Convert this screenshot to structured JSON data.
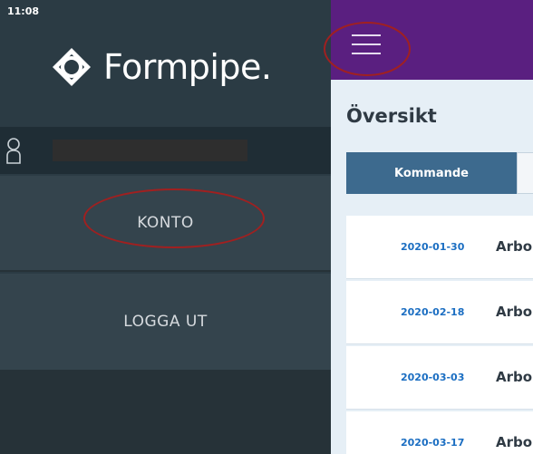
{
  "status_bar": {
    "time": "11:08"
  },
  "sidebar": {
    "logo_text": "Formpipe.",
    "menu": [
      {
        "label": "KONTO"
      },
      {
        "label": "LOGGA UT"
      }
    ]
  },
  "main": {
    "title": "Översikt",
    "tabs": [
      {
        "label": "Kommande"
      },
      {
        "label": ""
      }
    ],
    "items": [
      {
        "date": "2020-01-30",
        "title": "Arbo"
      },
      {
        "date": "2020-02-18",
        "title": "Arbo"
      },
      {
        "date": "2020-03-03",
        "title": "Arbo"
      },
      {
        "date": "2020-03-17",
        "title": "Arbo"
      }
    ]
  },
  "colors": {
    "sidebar_bg": "#2b3b44",
    "topbar_bg": "#5a1f80",
    "tab_active": "#3d6a8e",
    "date_link": "#1b6ec2",
    "annotation": "#a02020"
  },
  "icons": {
    "logo": "formpipe-logo-icon",
    "user": "user-icon",
    "menu": "hamburger-menu-icon"
  }
}
